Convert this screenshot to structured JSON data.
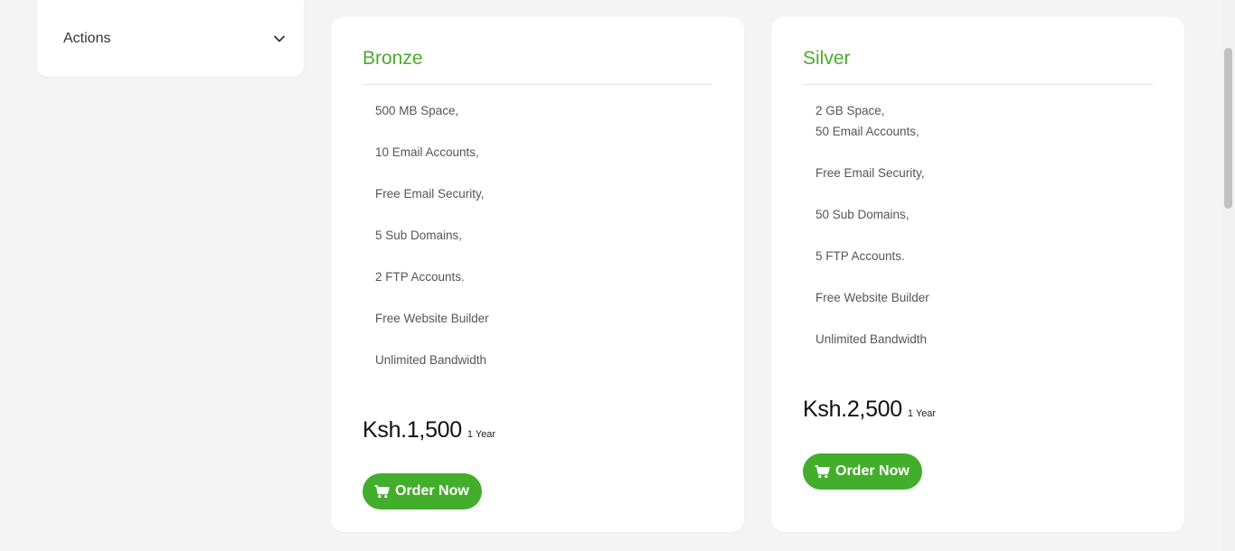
{
  "sidebar": {
    "actions_label": "Actions",
    "chevron_icon": "chevron-down-icon"
  },
  "products": [
    {
      "name": "Bronze",
      "features": [
        "500 MB Space,",
        "10 Email Accounts,",
        "Free Email Security,",
        "5 Sub Domains,",
        "2 FTP Accounts.",
        "Free Website Builder",
        "Unlimited Bandwidth"
      ],
      "price": "Ksh.1,500",
      "period": "1 Year",
      "order_label": "Order Now",
      "order_icon": "shopping-cart-icon"
    },
    {
      "name": "Silver",
      "features": [
        "2 GB Space,",
        "50 Email Accounts,",
        "Free Email Security,",
        "50 Sub Domains,",
        "5 FTP Accounts.",
        "Free Website Builder",
        "Unlimited Bandwidth"
      ],
      "price": "Ksh.2,500",
      "period": "1 Year",
      "order_label": "Order Now",
      "order_icon": "shopping-cart-icon"
    }
  ],
  "colors": {
    "accent_green": "#43ad2c",
    "title_green": "#4aac2c",
    "background": "#f4f4f4"
  }
}
